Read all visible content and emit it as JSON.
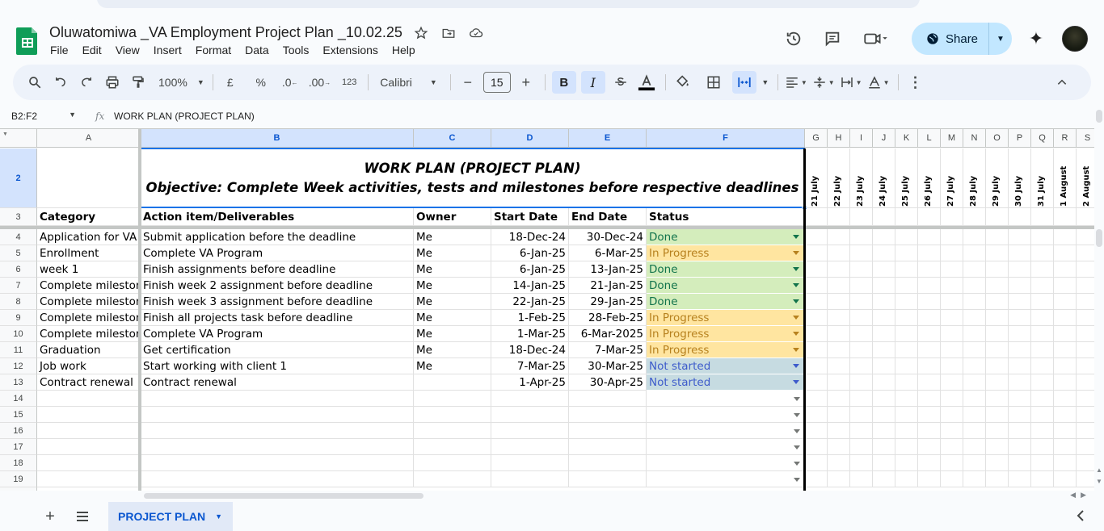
{
  "doc": {
    "title": "Oluwatomiwa _VA Employment Project Plan _10.02.25"
  },
  "menu": [
    "File",
    "Edit",
    "View",
    "Insert",
    "Format",
    "Data",
    "Tools",
    "Extensions",
    "Help"
  ],
  "share": {
    "label": "Share"
  },
  "toolbar": {
    "zoom": "100%",
    "currency": "£",
    "percent": "%",
    "dec_less": ".0",
    "dec_more": ".00",
    "num_format": "123",
    "font": "Calibri",
    "font_size": "15",
    "bold": "B",
    "italic": "I"
  },
  "formula_bar": {
    "namebox": "B2:F2",
    "fx": "fx",
    "content": "WORK PLAN (PROJECT PLAN)"
  },
  "columns": [
    "A",
    "B",
    "C",
    "D",
    "E",
    "F",
    "G",
    "H",
    "I",
    "J",
    "K",
    "L",
    "M",
    "N",
    "O",
    "P",
    "Q",
    "R",
    "S"
  ],
  "title_block": {
    "line1": "WORK PLAN (PROJECT PLAN)",
    "line2": "Objective: Complete Week  activities, tests and milestones before respective deadlines"
  },
  "timeline_dates": [
    "21 July",
    "22 July",
    "23 July",
    "24 July",
    "25 July",
    "26 July",
    "27 July",
    "28 July",
    "29 July",
    "30 July",
    "31 July",
    "1 August",
    "2 August"
  ],
  "table": {
    "headers": [
      "Category",
      "Action item/Deliverables",
      "Owner",
      "Start Date",
      "End Date",
      "Status"
    ],
    "rows": [
      {
        "n": "4",
        "category": "Application for VA",
        "action": "Submit application before the deadline",
        "owner": "Me",
        "start": "18-Dec-24",
        "end": "30-Dec-24",
        "status": "Done"
      },
      {
        "n": "5",
        "category": "Enrollment",
        "action": "Complete VA Program",
        "owner": "Me",
        "start": "6-Jan-25",
        "end": "6-Mar-25",
        "status": "In Progress"
      },
      {
        "n": "6",
        "category": "week 1",
        "action": "Finish assignments before deadline",
        "owner": "Me",
        "start": "6-Jan-25",
        "end": "13-Jan-25",
        "status": "Done"
      },
      {
        "n": "7",
        "category": "Complete mileston",
        "action": "Finish week 2 assignment before deadline",
        "owner": "Me",
        "start": "14-Jan-25",
        "end": "21-Jan-25",
        "status": "Done"
      },
      {
        "n": "8",
        "category": "Complete mileston",
        "action": "Finish week 3 assignment before deadline",
        "owner": "Me",
        "start": "22-Jan-25",
        "end": "29-Jan-25",
        "status": "Done"
      },
      {
        "n": "9",
        "category": "Complete mileston",
        "action": "Finish all projects task before deadline",
        "owner": "Me",
        "start": "1-Feb-25",
        "end": "28-Feb-25",
        "status": "In Progress"
      },
      {
        "n": "10",
        "category": "Complete mileston",
        "action": "Complete VA Program",
        "owner": "Me",
        "start": "1-Mar-25",
        "end": "6-Mar-2025",
        "status": "In Progress"
      },
      {
        "n": "11",
        "category": "Graduation",
        "action": "Get certification",
        "owner": "Me",
        "start": "18-Dec-24",
        "end": "7-Mar-25",
        "status": "In Progress"
      },
      {
        "n": "12",
        "category": "Job work",
        "action": "Start working with client 1",
        "owner": "Me",
        "start": "7-Mar-25",
        "end": "30-Mar-25",
        "status": "Not started"
      },
      {
        "n": "13",
        "category": "Contract renewal",
        "action": "Contract renewal",
        "owner": "",
        "start": "1-Apr-25",
        "end": "30-Apr-25",
        "status": "Not started"
      }
    ],
    "empty_rows": [
      "14",
      "15",
      "16",
      "17",
      "18",
      "19"
    ]
  },
  "row_numbers": {
    "title_row": "2",
    "header_row": "3"
  },
  "status_colors": {
    "Done": {
      "bg": "#d4edbc",
      "fg": "#11734b",
      "caret": "#11734b"
    },
    "In Progress": {
      "bg": "#ffe5a0",
      "fg": "#b7811e",
      "caret": "#b7811e"
    },
    "Not started": {
      "bg": "#c6dbe1",
      "fg": "#3d5bcb",
      "caret": "#3d5bcb"
    }
  },
  "sheet_tab": {
    "label": "PROJECT PLAN"
  }
}
